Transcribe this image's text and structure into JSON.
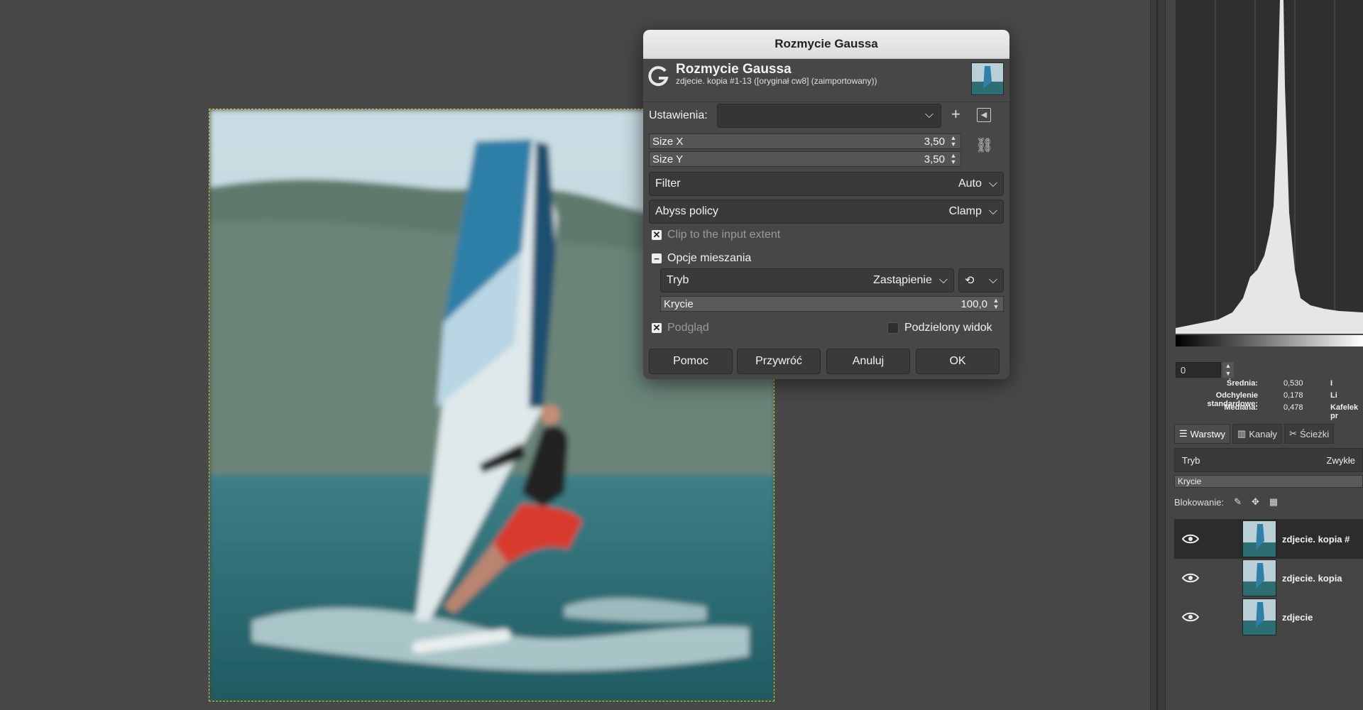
{
  "dialog": {
    "window_title": "Rozmycie Gaussa",
    "header_title": "Rozmycie Gaussa",
    "header_subtitle": "zdjecie. kopia #1-13 ([oryginał cw8] (zaimportowany))",
    "presets_label": "Ustawienia:",
    "presets_value": "",
    "size_x_label": "Size X",
    "size_x_value": "3,50",
    "size_y_label": "Size Y",
    "size_y_value": "3,50",
    "filter_label": "Filter",
    "filter_value": "Auto",
    "abyss_label": "Abyss policy",
    "abyss_value": "Clamp",
    "clip_label": "Clip to the input extent",
    "clip_checked": true,
    "blend_section_label": "Opcje mieszania",
    "mode_label": "Tryb",
    "mode_value": "Zastąpienie",
    "opacity_label": "Krycie",
    "opacity_value": "100,0",
    "preview_label": "Podgląd",
    "preview_checked": true,
    "split_view_label": "Podzielony widok",
    "split_view_checked": false,
    "buttons": {
      "help": "Pomoc",
      "reset": "Przywróć",
      "cancel": "Anuluj",
      "ok": "OK"
    }
  },
  "histogram": {
    "spin_value": "0",
    "stats": {
      "mean_label": "Średnia:",
      "mean_value": "0,530",
      "std_label": "Odchylenie standardowe:",
      "std_value": "0,178",
      "median_label": "Mediana:",
      "median_value": "0,478",
      "extra_1": "I",
      "extra_2": "Li",
      "extra_3": "Kafelek pr"
    }
  },
  "layers_panel": {
    "tabs": [
      "Warstwy",
      "Kanały",
      "Ścieżki"
    ],
    "mode_label": "Tryb",
    "mode_value": "Zwykłe",
    "opacity_label": "Krycie",
    "lock_label": "Blokowanie:",
    "layers": [
      {
        "name": "zdjecie. kopia #"
      },
      {
        "name": "zdjecie. kopia"
      },
      {
        "name": "zdjecie"
      }
    ]
  },
  "colors": {
    "canvas_bg": "#484848",
    "dialog_bg": "#474747",
    "selection_marquee": "#c8d42a",
    "sail_blue": "#2f7fa8",
    "water_teal": "#2c6e72"
  }
}
